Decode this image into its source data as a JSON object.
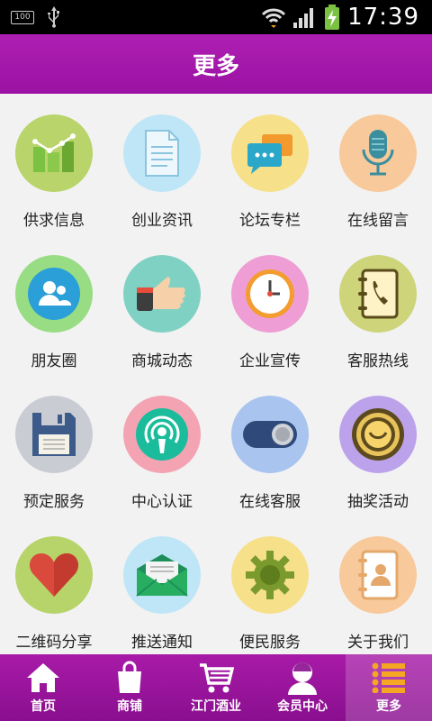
{
  "status": {
    "battery_small": "100",
    "time": "17:39"
  },
  "header": {
    "title": "更多"
  },
  "grid": [
    {
      "label": "供求信息",
      "icon": "chart-bars-icon",
      "bg": "#b8d46a"
    },
    {
      "label": "创业资讯",
      "icon": "document-icon",
      "bg": "#bfe6f7"
    },
    {
      "label": "论坛专栏",
      "icon": "chat-bubbles-icon",
      "bg": "#f6e08a"
    },
    {
      "label": "在线留言",
      "icon": "microphone-icon",
      "bg": "#f8c99a"
    },
    {
      "label": "朋友圈",
      "icon": "friends-icon",
      "bg": "#98dd84"
    },
    {
      "label": "商城动态",
      "icon": "thumbs-up-icon",
      "bg": "#7fd2c3"
    },
    {
      "label": "企业宣传",
      "icon": "clock-icon",
      "bg": "#ee9ed4"
    },
    {
      "label": "客服热线",
      "icon": "phonebook-icon",
      "bg": "#cdd47a"
    },
    {
      "label": "预定服务",
      "icon": "floppy-disk-icon",
      "bg": "#c9ccd3"
    },
    {
      "label": "中心认证",
      "icon": "podcast-icon",
      "bg": "#f4a3b2"
    },
    {
      "label": "在线客服",
      "icon": "toggle-switch-icon",
      "bg": "#a8c4ef"
    },
    {
      "label": "抽奖活动",
      "icon": "lucky-button-icon",
      "bg": "#bba2ea"
    },
    {
      "label": "二维码分享",
      "icon": "heart-icon",
      "bg": "#b7d46a"
    },
    {
      "label": "推送通知",
      "icon": "envelope-icon",
      "bg": "#bfe6f7"
    },
    {
      "label": "便民服务",
      "icon": "gear-icon",
      "bg": "#f6e08a"
    },
    {
      "label": "关于我们",
      "icon": "contact-card-icon",
      "bg": "#f8c99a"
    }
  ],
  "tabs": [
    {
      "label": "首页",
      "icon": "home-icon"
    },
    {
      "label": "商铺",
      "icon": "shopping-bag-icon"
    },
    {
      "label": "江门酒业",
      "icon": "cart-icon"
    },
    {
      "label": "会员中心",
      "icon": "user-icon"
    },
    {
      "label": "更多",
      "icon": "list-icon",
      "active": true
    }
  ]
}
